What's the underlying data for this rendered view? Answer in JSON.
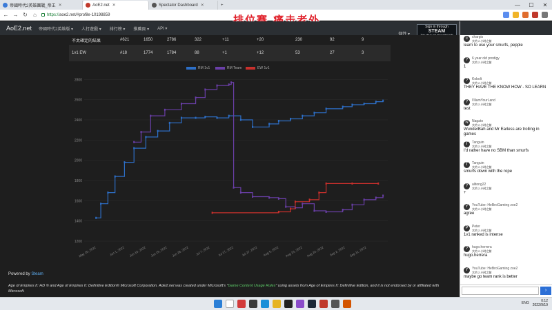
{
  "browser": {
    "tabs": [
      {
        "label": "帝國時代2英雄團戰_帝王",
        "color": "#3b7bd8",
        "active": false
      },
      {
        "label": "AoE2.net",
        "color": "#c0392b",
        "active": true
      },
      {
        "label": "Spectator Dashboard",
        "color": "#555555",
        "active": false
      }
    ],
    "address": {
      "protocol": "https://",
      "rest": "aoe2.net/#profile-10198859"
    },
    "window_controls": [
      "—",
      "☐",
      "✕"
    ]
  },
  "overlay": {
    "title": "排位赛 痛击老外"
  },
  "site": {
    "brand": "AoE2.net",
    "nav": [
      "帝國時代2英雄版 ▾",
      "人打遊戲 ▾",
      "排行榜 ▾",
      "推薦頁 ▾",
      "API ▾"
    ],
    "nav_right": "個性 ▾",
    "steam": {
      "small": "Sign in through",
      "big": "STEAM",
      "tiny": "This site is not associated with Valve Corp."
    }
  },
  "stats_table": {
    "rows": [
      [
        "不太確定的結果",
        "#621",
        "1650",
        "2786",
        "322",
        "+11",
        "+20",
        "230",
        "92",
        "9"
      ],
      [
        "1v1 EW",
        "#18",
        "1774",
        "1784",
        "88",
        "+1",
        "+12",
        "53",
        "27",
        "3"
      ]
    ]
  },
  "chart_data": {
    "type": "line",
    "legend_position": "top-center",
    "series": [
      {
        "name": "RM 1v1",
        "color": "#2d6fc7",
        "points": [
          [
            "2022-05-20",
            1430
          ],
          [
            "2022-05-22",
            1570
          ],
          [
            "2022-05-25",
            1680
          ],
          [
            "2022-05-28",
            1840
          ],
          [
            "2022-06-01",
            1980
          ],
          [
            "2022-06-05",
            2120
          ],
          [
            "2022-06-10",
            2230
          ],
          [
            "2022-06-15",
            2290
          ],
          [
            "2022-06-20",
            2370
          ],
          [
            "2022-06-25",
            2420
          ],
          [
            "2022-07-01",
            2420
          ],
          [
            "2022-07-05",
            2430
          ],
          [
            "2022-07-10",
            2420
          ],
          [
            "2022-07-15",
            2440
          ],
          [
            "2022-07-20",
            2400
          ],
          [
            "2022-07-25",
            2330
          ],
          [
            "2022-08-01",
            2360
          ],
          [
            "2022-08-05",
            2390
          ],
          [
            "2022-08-10",
            2410
          ],
          [
            "2022-08-15",
            2440
          ],
          [
            "2022-08-20",
            2470
          ],
          [
            "2022-08-25",
            2510
          ],
          [
            "2022-09-01",
            2530
          ],
          [
            "2022-09-05",
            2550
          ],
          [
            "2022-09-10",
            2560
          ],
          [
            "2022-09-15",
            2580
          ],
          [
            "2022-09-18",
            2590
          ]
        ]
      },
      {
        "name": "RM Team",
        "color": "#6a3fa8",
        "points": [
          [
            "2022-06-05",
            2180
          ],
          [
            "2022-06-08",
            2280
          ],
          [
            "2022-06-12",
            2440
          ],
          [
            "2022-06-18",
            2500
          ],
          [
            "2022-06-25",
            2560
          ],
          [
            "2022-07-01",
            2620
          ],
          [
            "2022-07-05",
            2700
          ],
          [
            "2022-07-10",
            2740
          ],
          [
            "2022-07-15",
            2750
          ],
          [
            "2022-07-16",
            2770
          ],
          [
            "2022-07-17",
            1730
          ],
          [
            "2022-07-20",
            1680
          ],
          [
            "2022-07-25",
            1640
          ],
          [
            "2022-08-01",
            1630
          ],
          [
            "2022-08-05",
            1620
          ],
          [
            "2022-08-08",
            1540
          ],
          [
            "2022-08-12",
            1530
          ],
          [
            "2022-08-15",
            1570
          ],
          [
            "2022-08-20",
            1500
          ],
          [
            "2022-08-25",
            1490
          ],
          [
            "2022-09-01",
            1510
          ],
          [
            "2022-09-05",
            1560
          ],
          [
            "2022-09-10",
            1610
          ],
          [
            "2022-09-15",
            1630
          ],
          [
            "2022-09-18",
            1650
          ]
        ]
      },
      {
        "name": "EW 1v1",
        "color": "#c9302c",
        "points": [
          [
            "2022-07-08",
            1480
          ],
          [
            "2022-08-05",
            1490
          ],
          [
            "2022-08-10",
            1520
          ],
          [
            "2022-08-12",
            1590
          ],
          [
            "2022-08-18",
            1610
          ],
          [
            "2022-08-22",
            1680
          ],
          [
            "2022-08-25",
            1770
          ],
          [
            "2022-09-05",
            1770
          ],
          [
            "2022-09-16",
            1770
          ]
        ]
      }
    ],
    "y_ticks": [
      1200,
      1400,
      1600,
      1800,
      2000,
      2200,
      2400,
      2600,
      2800
    ],
    "ylim": [
      1200,
      2850
    ],
    "x_ticks": [
      "May 20, 2022",
      "Jun 1, 2022",
      "Jun 10, 2022",
      "Jun 19, 2022",
      "Jun 28, 2022",
      "Jul 7, 2022",
      "Jul 17, 2022",
      "Jul 27, 2022",
      "Aug 5, 2022",
      "Aug 15, 2022",
      "Aug 24, 2022",
      "Sep 2, 2022",
      "Sep 11, 2022"
    ],
    "xlim": [
      "2022-05-15",
      "2022-09-20"
    ],
    "grid": true
  },
  "footer": {
    "powered_prefix": "Powered by ",
    "powered_link": "Steam",
    "disclaimer_a": "Age of Empires II: HD © and Age of Empires II: Definitive Edition© Microsoft Corporation. AoE2.net was created under Microsoft's \"",
    "disclaimer_link": "Game Content Usage Rules",
    "disclaimer_b": "\" using assets from Age of Empires II: Definitive Edition, and it is not endorsed by or affiliated with Microsoft."
  },
  "chat": {
    "messages": [
      {
        "name": "chargis",
        "time": "大约 2 小时之前",
        "text": "learn to use your smurfs, pepple",
        "avatar": "c"
      },
      {
        "name": "6 year old prodigy",
        "time": "大约 2 小时之前",
        "text": "1",
        "avatar": "?"
      },
      {
        "name": "Kobolt",
        "time": "大约 2 小时之前",
        "text": "THEY HAVE THE KNOW HOW - SO LEARN",
        "avatar": "?"
      },
      {
        "name": "I'lllamYourLand",
        "time": "大约 2 小时之前",
        "text": "test",
        "avatar": "?"
      },
      {
        "name": "Nagato",
        "time": "大约 2 小时之前",
        "text": "WunderBah and Mr Earless are trolling in",
        "text2": "games",
        "avatar": "N"
      },
      {
        "name": "Tanguin",
        "time": "大约 2 小时之前",
        "text": "I'd rather have no SBM than smurfs",
        "avatar": "T"
      },
      {
        "name": "Tanguin",
        "time": "大约 2 小时之前",
        "text": "smurfs down with the rope",
        "avatar": "T"
      },
      {
        "name": "alitong22",
        "time": "大约 2 小时之前",
        "text": "+",
        "avatar": "?"
      },
      {
        "name": "YouTube: HeBroGaming zoe2",
        "time": "大约 2 小时之前",
        "text": "agree",
        "avatar": "Y"
      },
      {
        "name": "Peter",
        "time": "大约 2 小时之前",
        "text": "1v1 ranked is intense",
        "avatar": "P"
      },
      {
        "name": "hugo.herrera",
        "time": "大约 2 小时之前",
        "text": "hugo.herrera",
        "avatar": "?"
      },
      {
        "name": "YouTube: HeBroGaming zoe2",
        "time": "大约 2 小时之前",
        "text": "maybe go team rank is better",
        "avatar": "Y"
      }
    ],
    "send_icon": "›"
  },
  "taskbar": {
    "tray_lang": "ENG",
    "time": "0:12",
    "date": "2022/9/19"
  }
}
